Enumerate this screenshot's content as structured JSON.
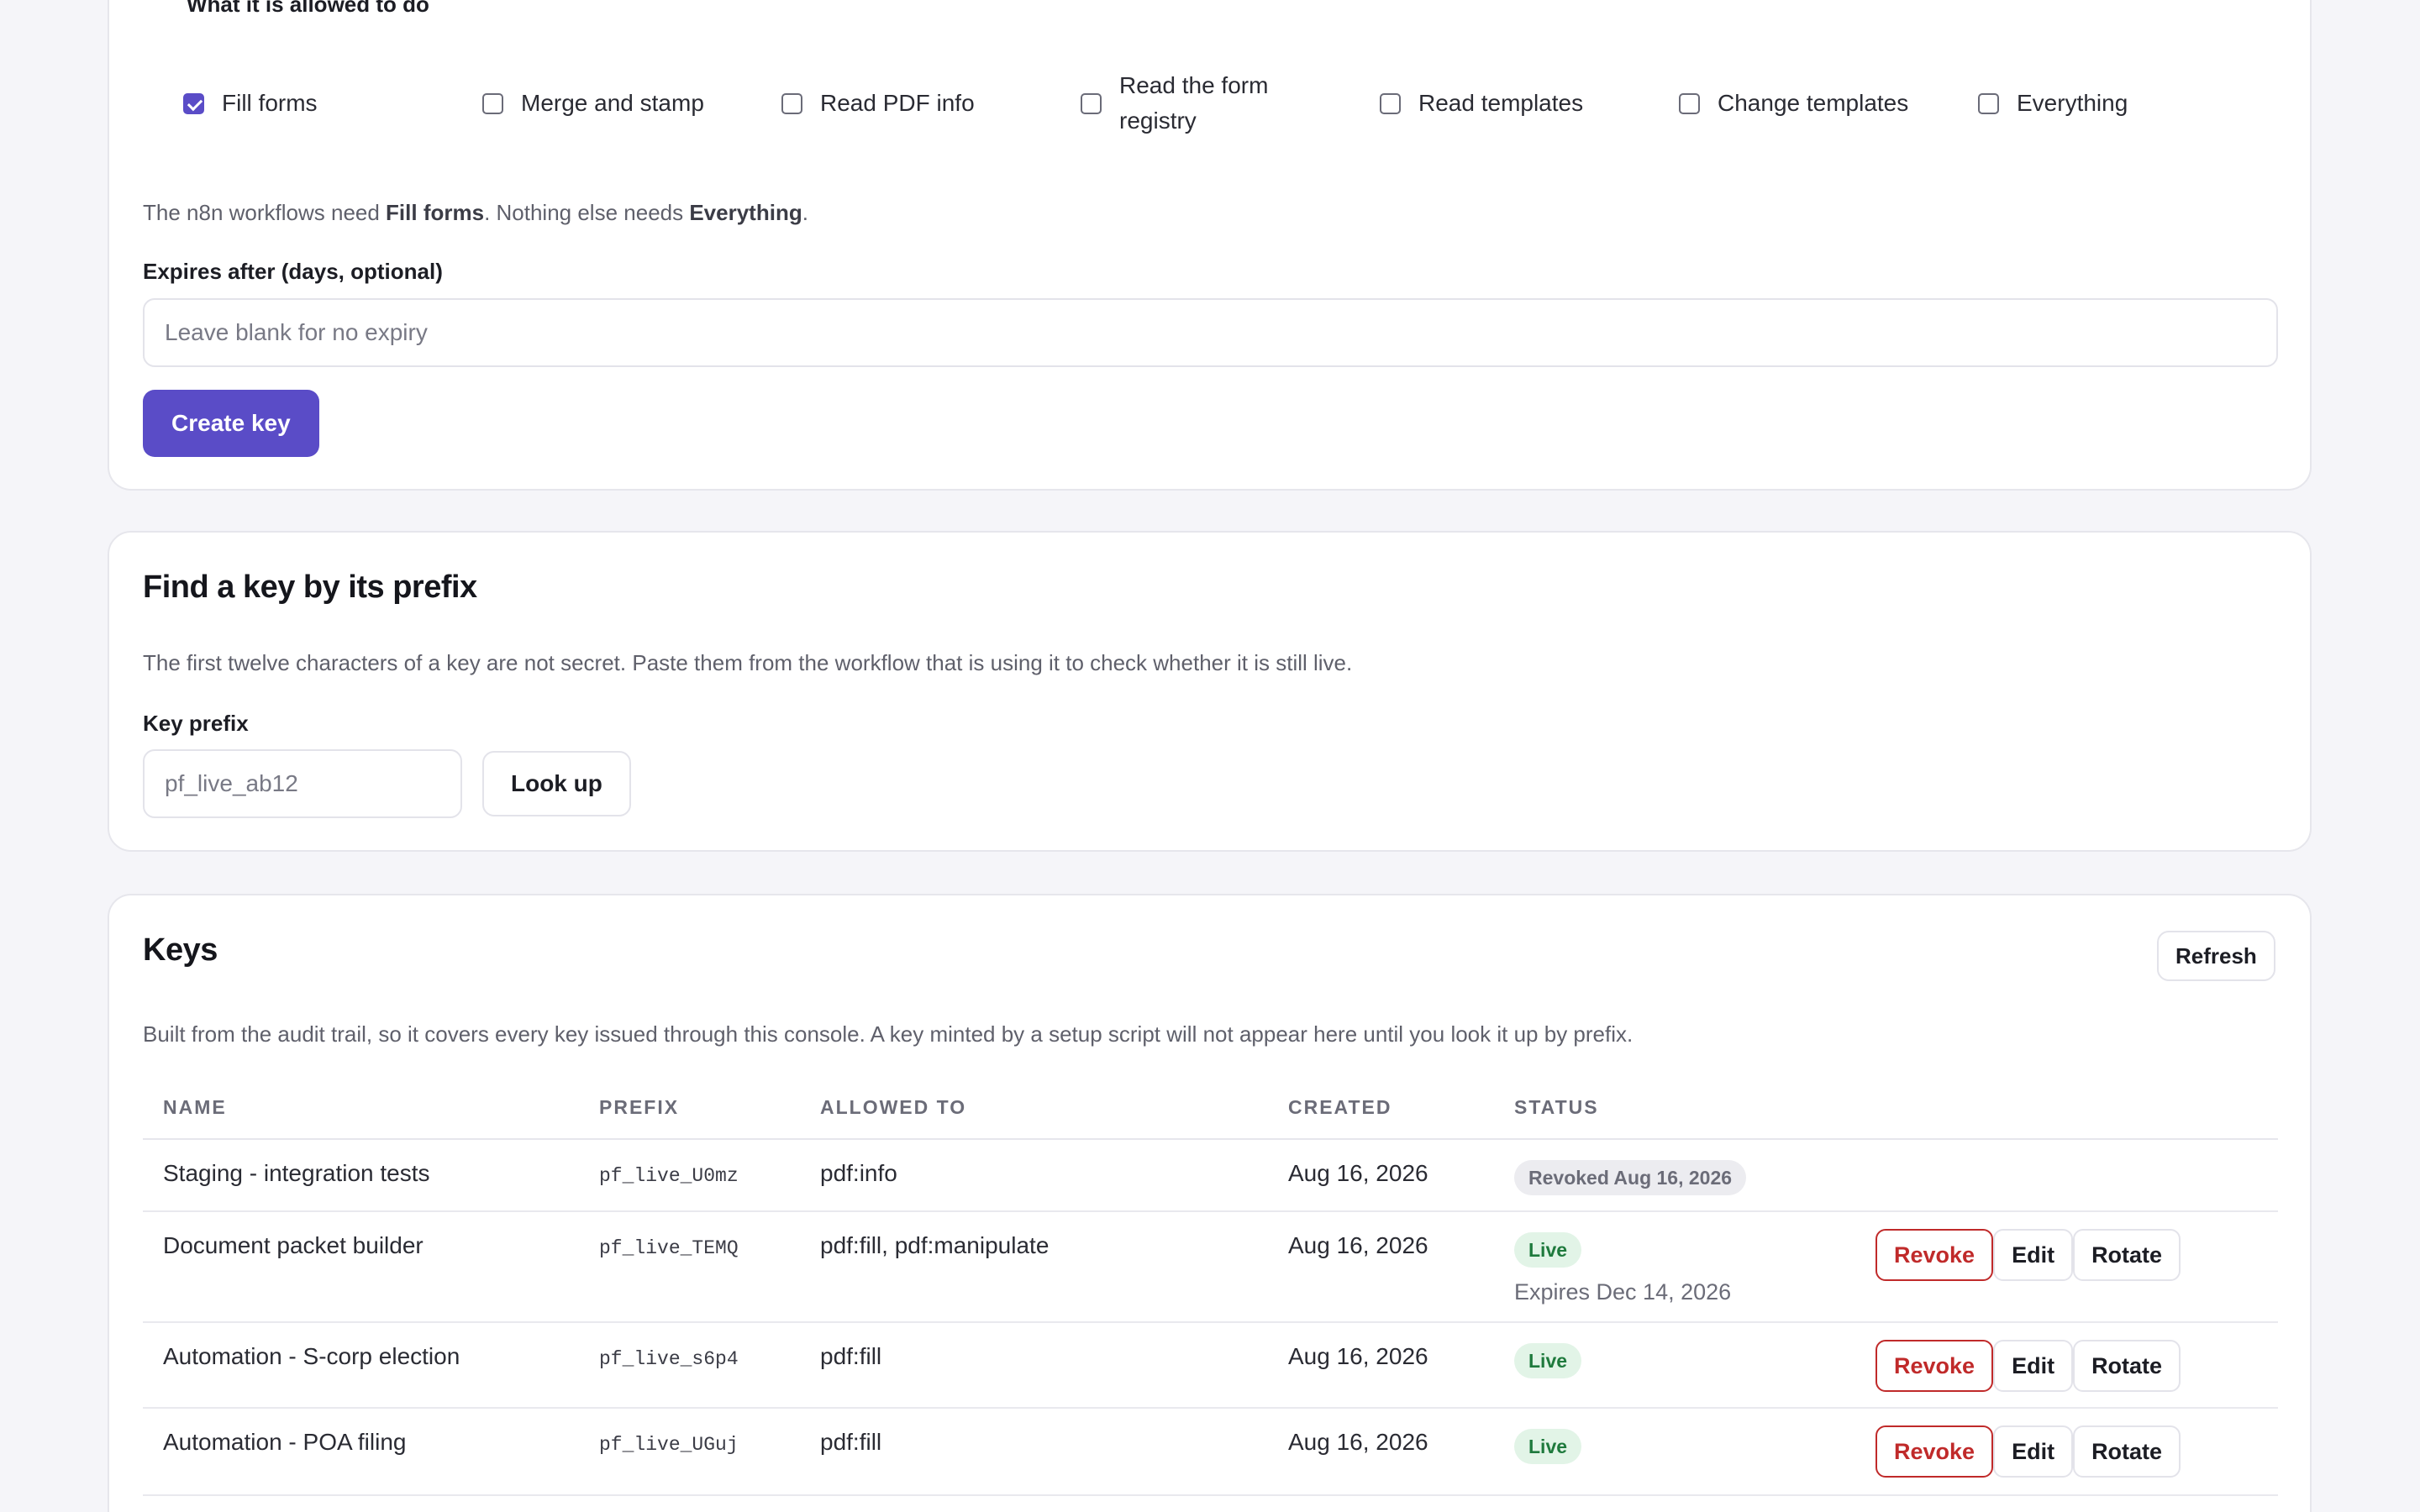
{
  "create_key": {
    "scopes_label": "What it is allowed to do",
    "scopes": [
      {
        "label": "Fill forms",
        "checked": true
      },
      {
        "label": "Merge and stamp",
        "checked": false
      },
      {
        "label": "Read PDF info",
        "checked": false
      },
      {
        "label": "Read the form registry",
        "checked": false
      },
      {
        "label": "Read templates",
        "checked": false
      },
      {
        "label": "Change templates",
        "checked": false
      },
      {
        "label": "Everything",
        "checked": false
      }
    ],
    "note_prefix": "The n8n workflows need ",
    "note_bold_1": "Fill forms",
    "note_middle": ". Nothing else needs ",
    "note_bold_2": "Everything",
    "note_suffix": ".",
    "expires_label": "Expires after (days, optional)",
    "expires_placeholder": "Leave blank for no expiry",
    "expires_value": "",
    "create_button": "Create key"
  },
  "find_key": {
    "title": "Find a key by its prefix",
    "description": "The first twelve characters of a key are not secret. Paste them from the workflow that is using it to check whether it is still live.",
    "prefix_label": "Key prefix",
    "prefix_placeholder": "pf_live_ab12",
    "prefix_value": "",
    "lookup_button": "Look up"
  },
  "keys": {
    "title": "Keys",
    "refresh_button": "Refresh",
    "description": "Built from the audit trail, so it covers every key issued through this console. A key minted by a setup script will not appear here until you look it up by prefix.",
    "columns": [
      "NAME",
      "PREFIX",
      "ALLOWED TO",
      "CREATED",
      "STATUS"
    ],
    "rows": [
      {
        "name": "Staging - integration tests",
        "prefix": "pf_live_U0mz",
        "allowed": "pdf:info",
        "created": "Aug 16, 2026",
        "status": "Revoked Aug 16, 2026",
        "status_kind": "revoked",
        "expires": "",
        "actions": []
      },
      {
        "name": "Document packet builder",
        "prefix": "pf_live_TEMQ",
        "allowed": "pdf:fill, pdf:manipulate",
        "created": "Aug 16, 2026",
        "status": "Live",
        "status_kind": "live",
        "expires": "Expires Dec 14, 2026",
        "actions": [
          "Revoke",
          "Edit",
          "Rotate"
        ]
      },
      {
        "name": "Automation - S-corp election",
        "prefix": "pf_live_s6p4",
        "allowed": "pdf:fill",
        "created": "Aug 16, 2026",
        "status": "Live",
        "status_kind": "live",
        "expires": "",
        "actions": [
          "Revoke",
          "Edit",
          "Rotate"
        ]
      },
      {
        "name": "Automation - POA filing",
        "prefix": "pf_live_UGuj",
        "allowed": "pdf:fill",
        "created": "Aug 16, 2026",
        "status": "Live",
        "status_kind": "live",
        "expires": "",
        "actions": [
          "Revoke",
          "Edit",
          "Rotate"
        ]
      }
    ]
  },
  "colors": {
    "accent": "#5a4cc7",
    "danger": "#c02a2a",
    "live": "#1f7a3d",
    "page_bg": "#f5f5f9"
  }
}
